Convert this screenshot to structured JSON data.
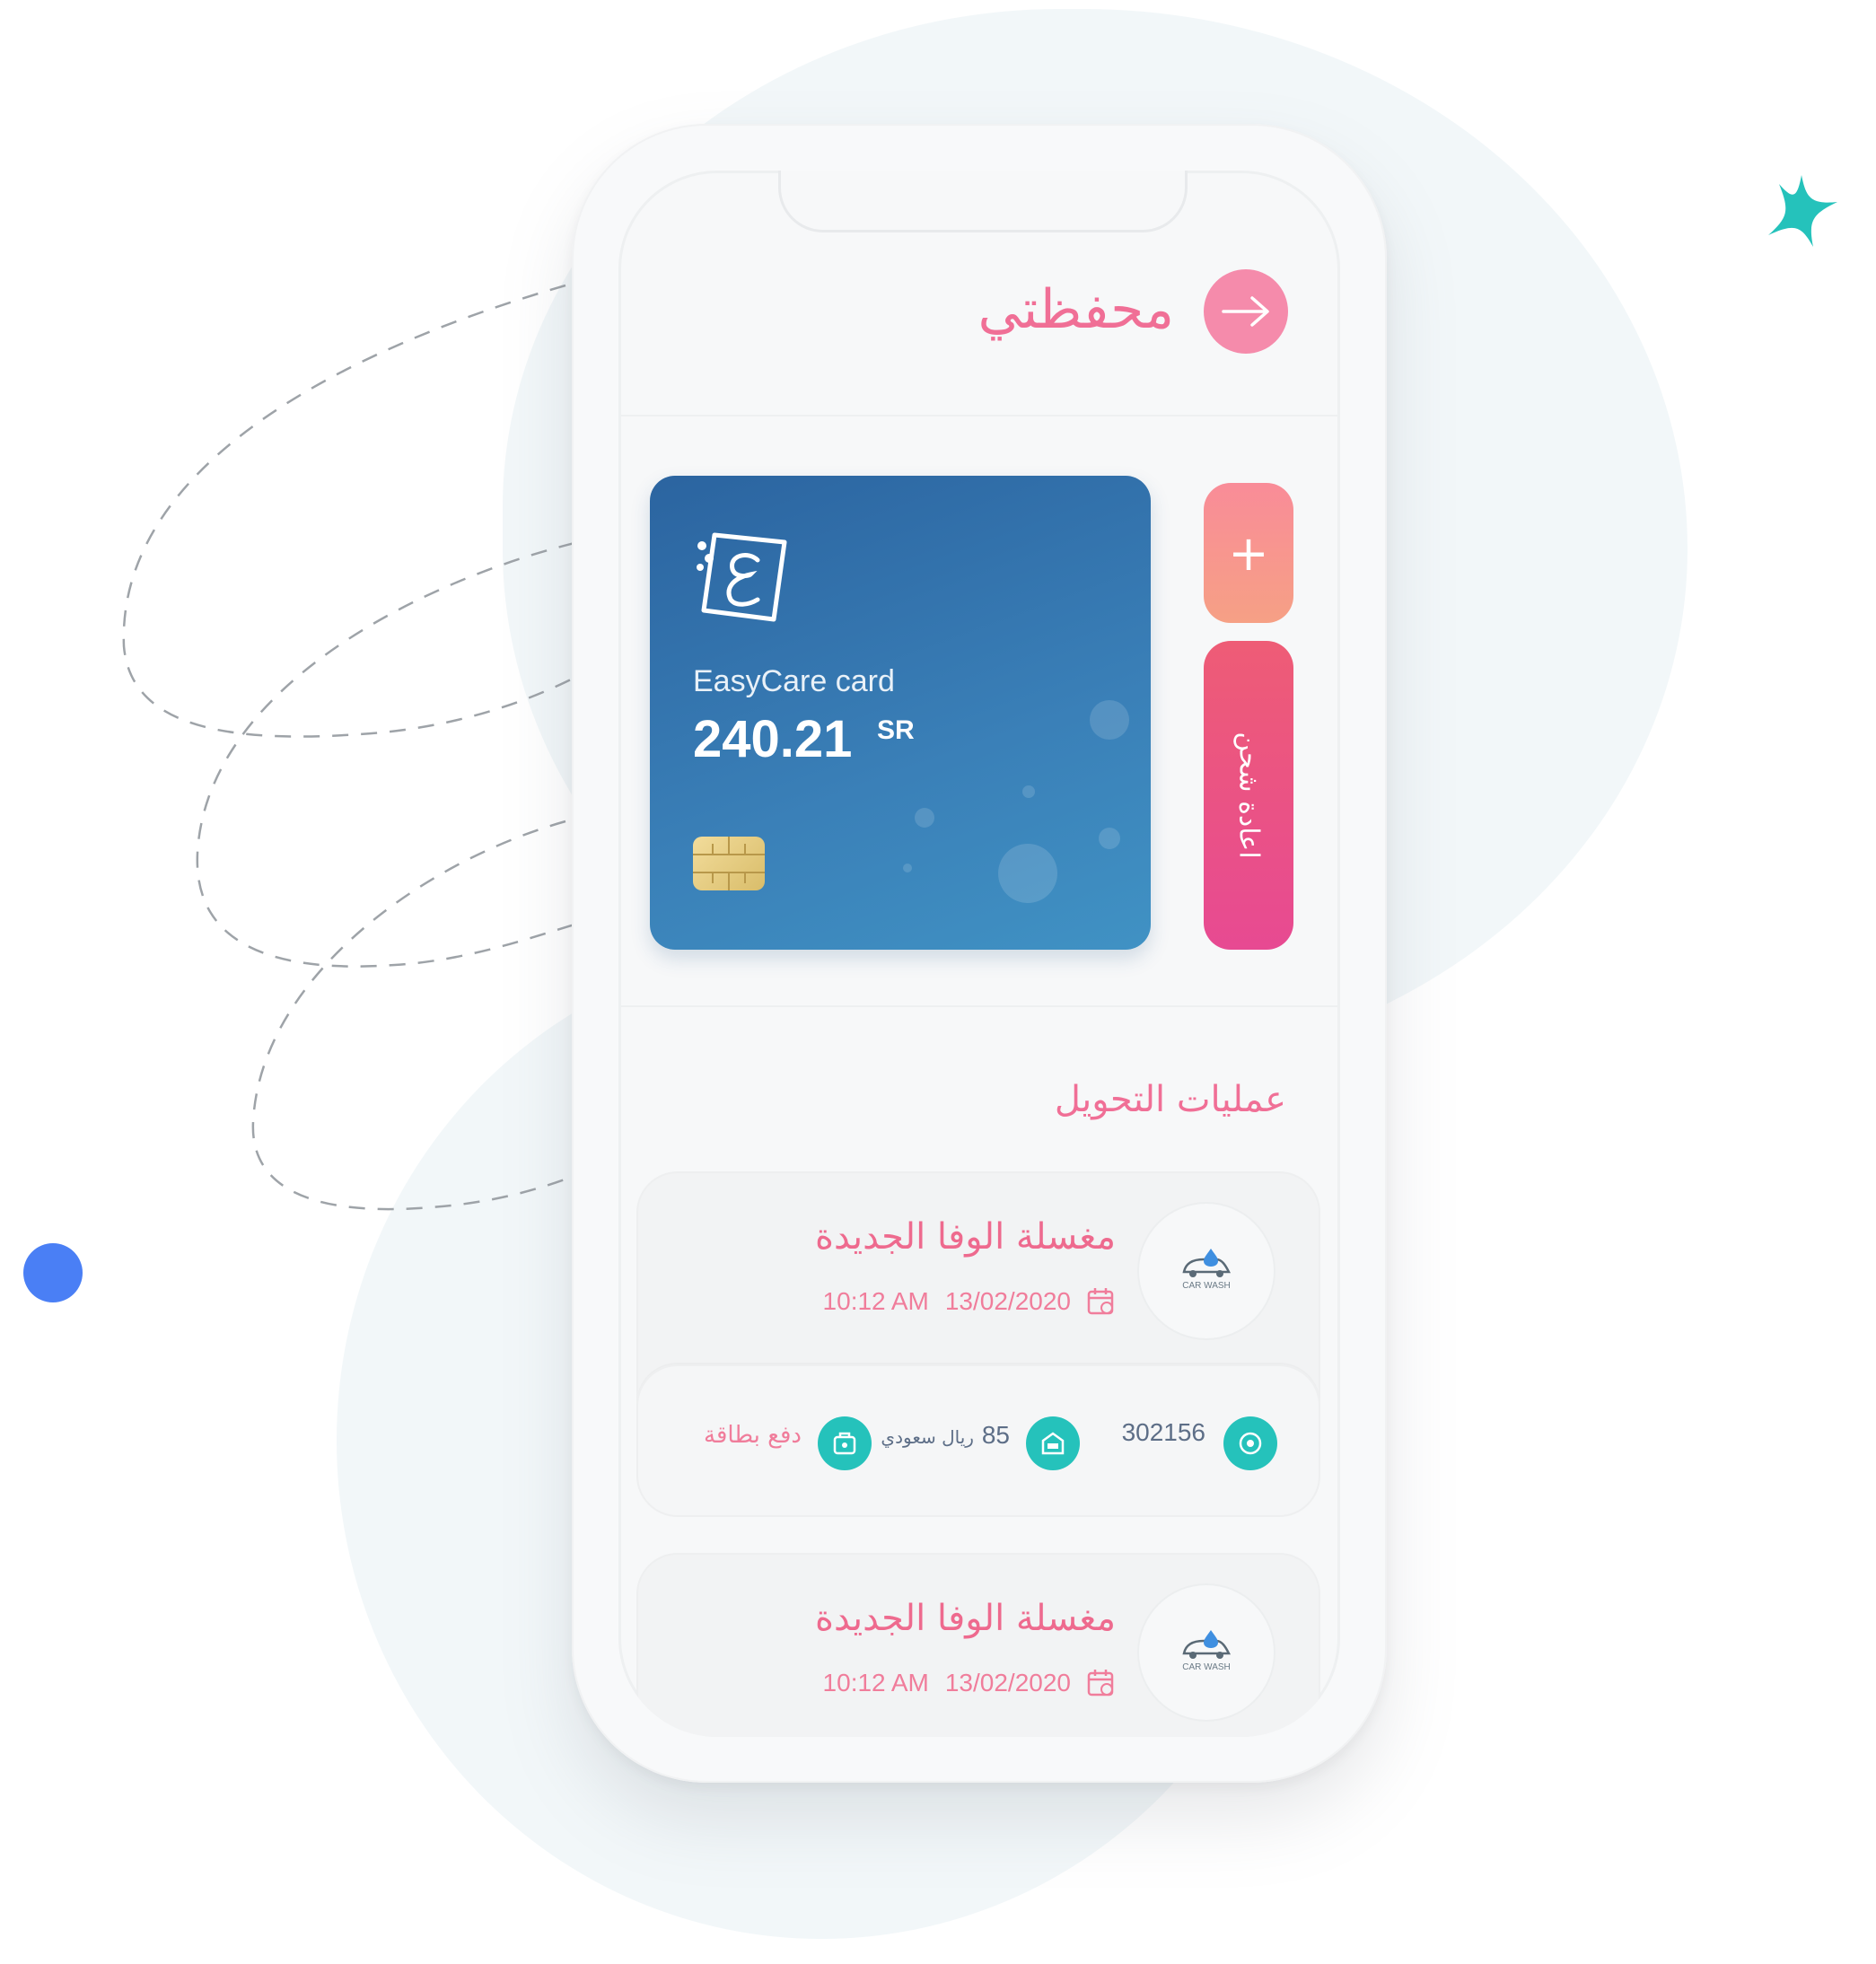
{
  "screen": {
    "title": "محفظتي",
    "back_icon": "arrow-right-icon"
  },
  "card": {
    "name": "EasyCare card",
    "balance": "240.21",
    "currency": "SR",
    "logo_letter": "ع"
  },
  "actions": {
    "add_label": "+",
    "recharge_label": "اعادة شحن"
  },
  "transactions": {
    "section_title": "عمليات التحويل",
    "items": [
      {
        "merchant": "مغسلة الوفا الجديدة",
        "time": "10:12 AM",
        "date": "13/02/2020",
        "logo_caption": "CAR WASH",
        "code": "302156",
        "amount": "85",
        "currency": "ريال سعودي",
        "payment_method": "دفع بطاقة"
      },
      {
        "merchant": "مغسلة الوفا الجديدة",
        "time": "10:12 AM",
        "date": "13/02/2020",
        "logo_caption": "CAR WASH"
      }
    ]
  },
  "colors": {
    "accent_pink": "#f06f96",
    "card_blue": "#2b64a0",
    "teal": "#25c2bb",
    "dot_blue": "#4a7ff5"
  }
}
